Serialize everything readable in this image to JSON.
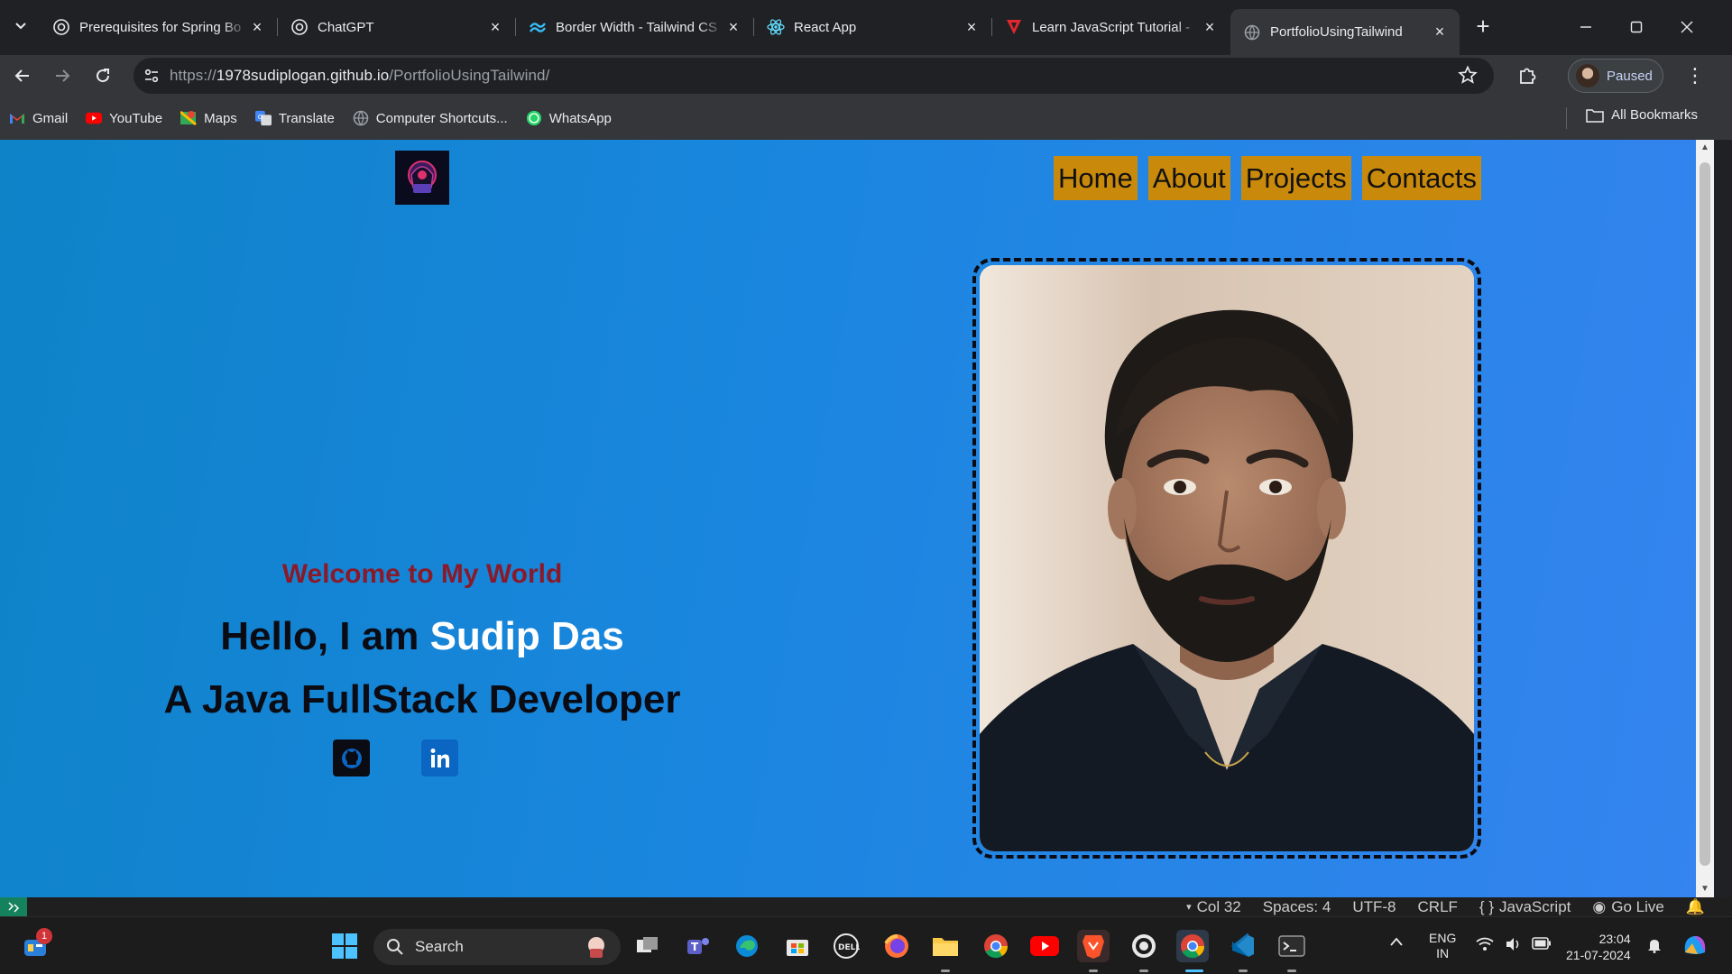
{
  "browser": {
    "tabs": [
      {
        "title": "Prerequisites for Spring Bo",
        "icon": "chatgpt-icon"
      },
      {
        "title": "ChatGPT",
        "icon": "chatgpt-icon"
      },
      {
        "title": "Border Width - Tailwind CS",
        "icon": "tailwind-icon"
      },
      {
        "title": "React App",
        "icon": "react-icon"
      },
      {
        "title": "Learn JavaScript Tutorial -",
        "icon": "v-logo-icon"
      },
      {
        "title": "PortfolioUsingTailwind",
        "icon": "globe-icon",
        "active": true
      }
    ],
    "url_prefix": "https://",
    "url_host": "1978sudiplogan.github.io",
    "url_path": "/PortfolioUsingTailwind/",
    "profile_label": "Paused"
  },
  "bookmarks": {
    "items": [
      {
        "label": "Gmail",
        "icon": "gmail-icon"
      },
      {
        "label": "YouTube",
        "icon": "youtube-icon"
      },
      {
        "label": "Maps",
        "icon": "maps-icon"
      },
      {
        "label": "Translate",
        "icon": "translate-icon"
      },
      {
        "label": "Computer Shortcuts...",
        "icon": "globe-icon"
      },
      {
        "label": "WhatsApp",
        "icon": "whatsapp-icon"
      }
    ],
    "all_label": "All Bookmarks"
  },
  "page": {
    "nav": [
      "Home",
      "About",
      "Projects",
      "Contacts"
    ],
    "welcome": "Welcome to My World",
    "hello_prefix": "Hello, I am ",
    "name": "Sudip Das",
    "role": "A Java FullStack Developer",
    "social": [
      "github-icon",
      "linkedin-icon"
    ],
    "colors": {
      "nav_bg": "#c98a0c",
      "welcome": "#8a1a2a",
      "bg_start": "#0e83c8",
      "bg_end": "#3584ef"
    }
  },
  "vscode_status": {
    "col": "Col 32",
    "spaces": "Spaces: 4",
    "encoding": "UTF-8",
    "eol": "CRLF",
    "language": "JavaScript",
    "golive": "Go Live"
  },
  "taskbar": {
    "search_label": "Search",
    "widgets_badge": "1",
    "lang_top": "ENG",
    "lang_bottom": "IN",
    "time": "23:04",
    "date": "21-07-2024"
  }
}
